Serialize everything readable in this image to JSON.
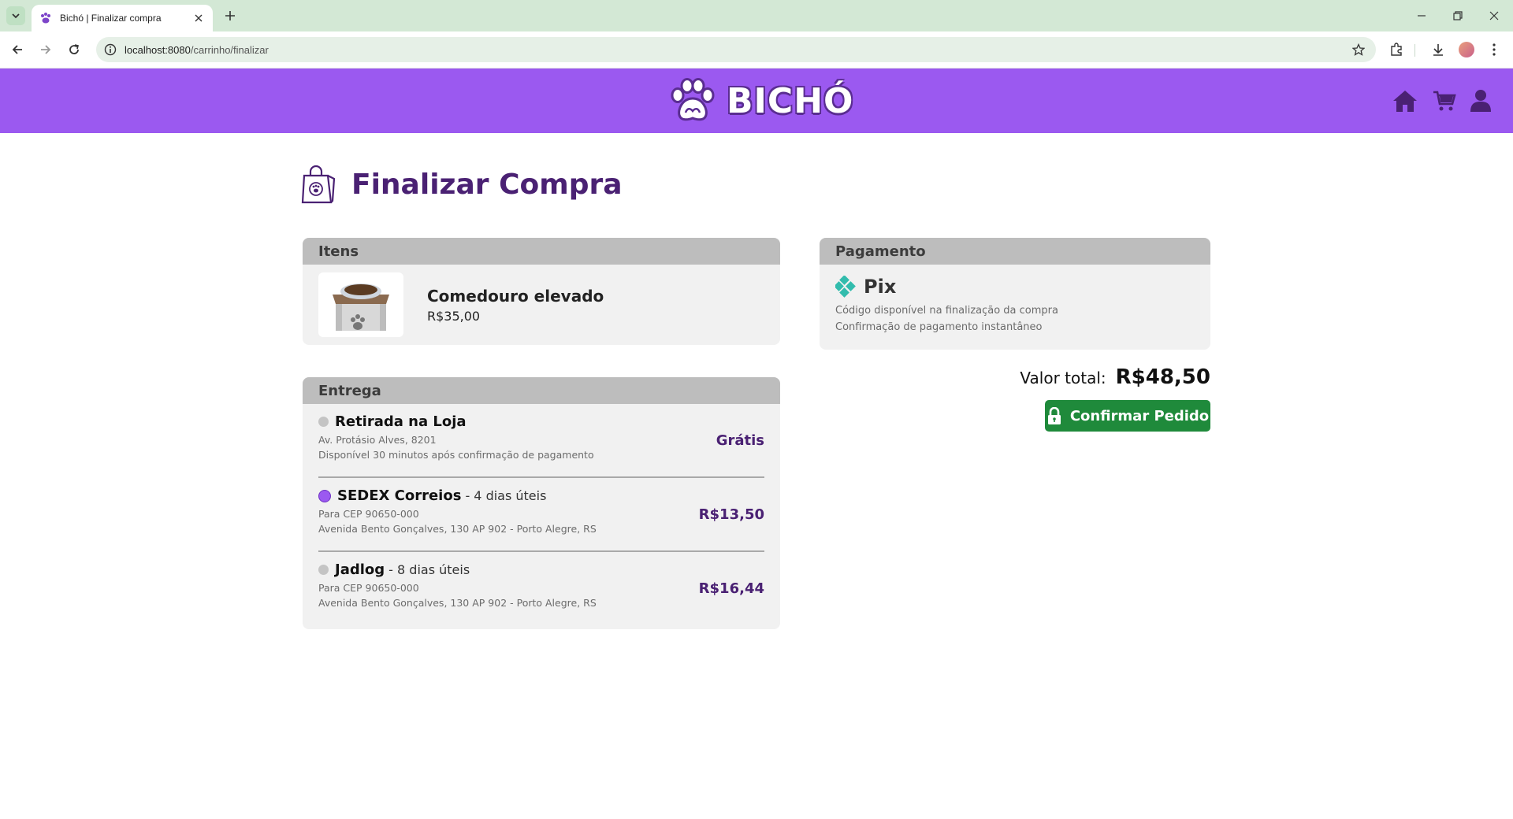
{
  "browser": {
    "tab_title": "Bichó | Finalizar compra",
    "url_host": "localhost:8080",
    "url_path": "/carrinho/finalizar"
  },
  "header": {
    "logo_text": "BICHÓ",
    "brand_color": "#9b59f0",
    "nav_icons": [
      "home-icon",
      "cart-icon",
      "user-icon"
    ]
  },
  "page": {
    "title": "Finalizar Compra"
  },
  "items": {
    "heading": "Itens",
    "list": [
      {
        "name": "Comedouro elevado",
        "price": "R$35,00"
      }
    ]
  },
  "delivery": {
    "heading": "Entrega",
    "options": [
      {
        "name": "Retirada na Loja",
        "days": "",
        "line1": "Av. Protásio Alves, 8201",
        "line2": "Disponível 30 minutos após confirmação de pagamento",
        "price": "Grátis",
        "selected": false
      },
      {
        "name": "SEDEX Correios",
        "days": "- 4 dias úteis",
        "line1": "Para CEP 90650-000",
        "line2": "Avenida Bento Gonçalves, 130 AP 902 - Porto Alegre, RS",
        "price": "R$13,50",
        "selected": true
      },
      {
        "name": "Jadlog",
        "days": "- 8 dias úteis",
        "line1": "Para CEP 90650-000",
        "line2": "Avenida Bento Gonçalves, 130 AP 902 - Porto Alegre, RS",
        "price": "R$16,44",
        "selected": false
      }
    ]
  },
  "payment": {
    "heading": "Pagamento",
    "method": "Pix",
    "desc_line1": "Código disponível na finalização da compra",
    "desc_line2": "Confirmação de pagamento instantâneo"
  },
  "summary": {
    "total_label": "Valor total:",
    "total_value": "R$48,50",
    "confirm_label": "Confirmar Pedido"
  }
}
